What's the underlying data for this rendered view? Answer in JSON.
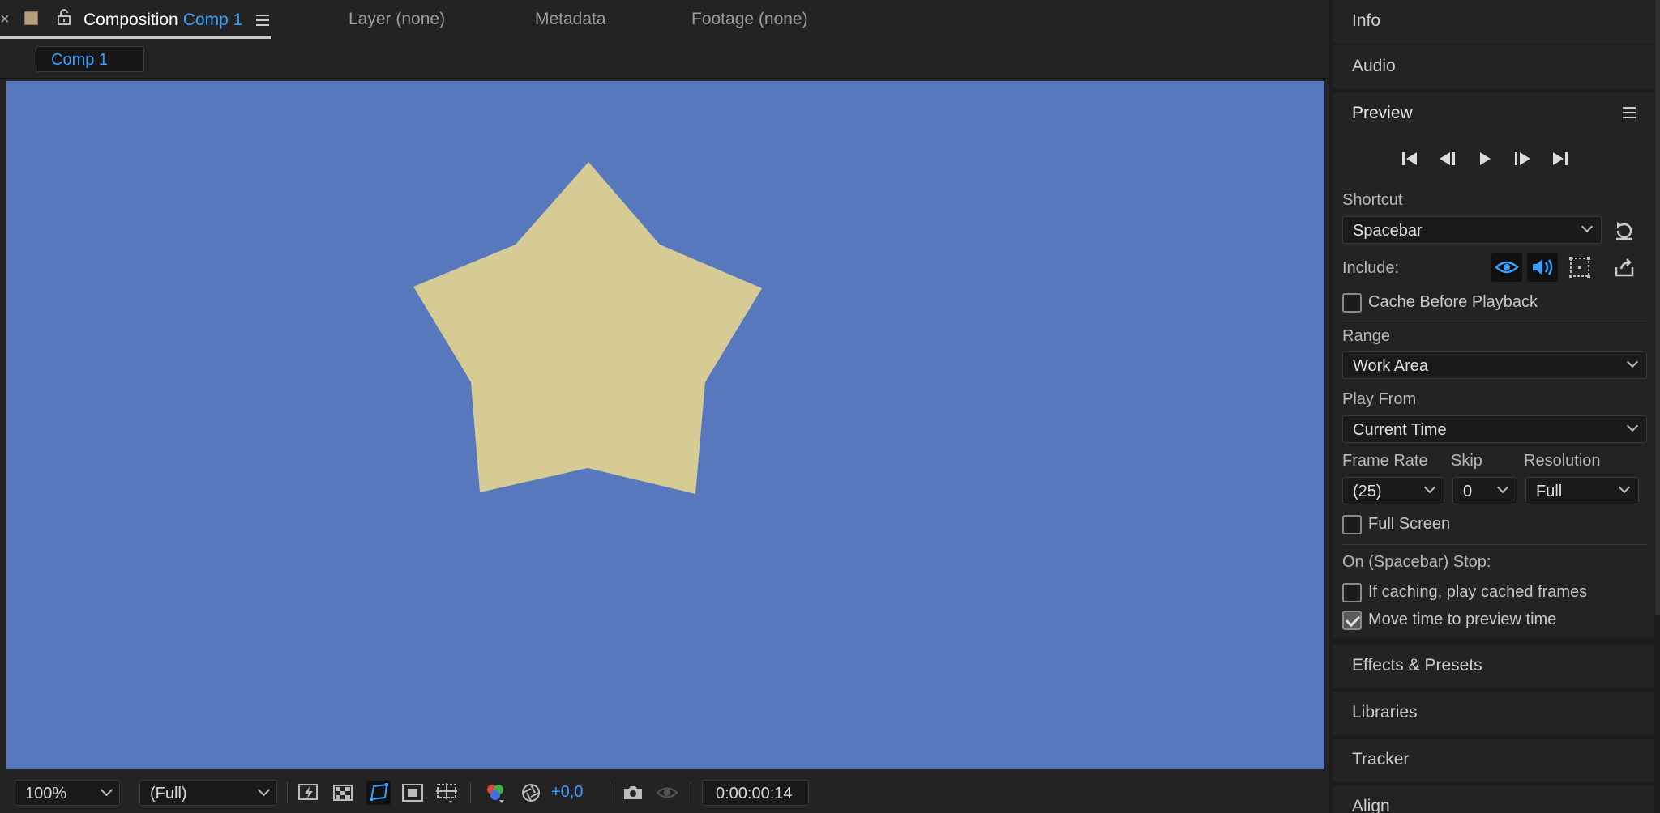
{
  "composition_panel": {
    "tabs": {
      "close_glyph": "×",
      "composition_label": "Composition",
      "composition_name": "Comp 1",
      "layer": "Layer (none)",
      "metadata": "Metadata",
      "footage": "Footage (none)"
    },
    "active_comp_chip": "Comp 1",
    "viewer": {
      "background_color": "#5878be",
      "star_color": "#d7cb95"
    },
    "toolbar": {
      "zoom": "100%",
      "resolution": "(Full)",
      "exposure": "+0,0",
      "timecode": "0:00:00:14"
    }
  },
  "right_panel": {
    "sections": {
      "info": "Info",
      "audio": "Audio",
      "preview": "Preview",
      "effects_presets": "Effects & Presets",
      "libraries": "Libraries",
      "tracker": "Tracker",
      "align": "Align"
    },
    "preview": {
      "shortcut_label": "Shortcut",
      "shortcut_value": "Spacebar",
      "include_label": "Include:",
      "cache_before_playback": {
        "label": "Cache Before Playback",
        "checked": false
      },
      "range_label": "Range",
      "range_value": "Work Area",
      "play_from_label": "Play From",
      "play_from_value": "Current Time",
      "frame_rate_label": "Frame Rate",
      "frame_rate_value": "(25)",
      "skip_label": "Skip",
      "skip_value": "0",
      "resolution_label": "Resolution",
      "resolution_value": "Full",
      "full_screen": {
        "label": "Full Screen",
        "checked": false
      },
      "on_stop_label": "On (Spacebar) Stop:",
      "if_caching": {
        "label": "If caching, play cached frames",
        "checked": false
      },
      "move_time": {
        "label": "Move time to preview time",
        "checked": true
      }
    }
  },
  "colors": {
    "accent_blue": "#3aa0ff",
    "panel_bg": "#232323"
  }
}
